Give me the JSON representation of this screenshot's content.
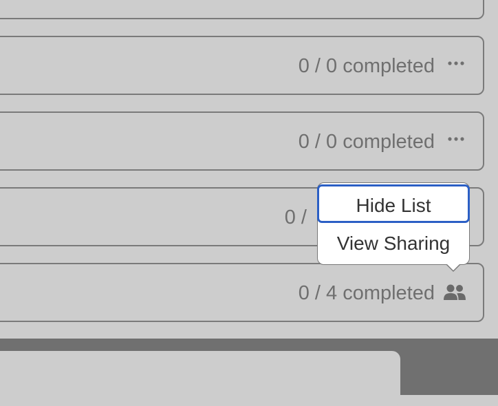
{
  "lists": [
    {
      "status": "",
      "icon": "more-icon"
    },
    {
      "status": "0 / 0 completed",
      "icon": "more-icon"
    },
    {
      "status": "0 / 0 completed",
      "icon": "more-icon"
    },
    {
      "status": "0 / ",
      "icon": "more-icon"
    },
    {
      "status": "0 / 4 completed",
      "icon": "shared-people-icon"
    }
  ],
  "popover": {
    "hide_list": "Hide List",
    "view_sharing": "View Sharing"
  },
  "colors": {
    "background": "#cdcdcd",
    "border": "#7a7a7a",
    "text": "#6f6f6f",
    "focus": "#2b5fc5",
    "footer": "#707070"
  }
}
